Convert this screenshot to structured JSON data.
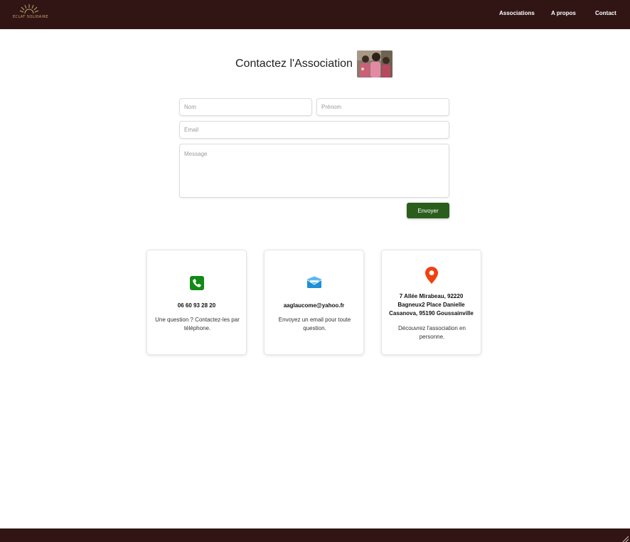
{
  "header": {
    "logo_text": "ECLAT SOLIDAIRE",
    "logo_icon": "sunrise-icon",
    "nav": [
      "Associations",
      "A propos",
      "Contact"
    ]
  },
  "page": {
    "title": "Contactez l'Association",
    "title_image": "group-photo"
  },
  "form": {
    "nom_placeholder": "Nom",
    "prenom_placeholder": "Prénom",
    "email_placeholder": "Email",
    "message_placeholder": "Message",
    "submit_label": "Envoyer"
  },
  "cards": {
    "phone": {
      "icon": "phone-icon",
      "value": "06 60 93 28 20",
      "description": "Une question ? Contactez-les par téléphone."
    },
    "email": {
      "icon": "envelope-icon",
      "value": "aaglaucome@yahoo.fr",
      "description": "Envoyez un email pour toute question."
    },
    "address": {
      "icon": "map-pin-icon",
      "value": "7 Allée Mirabeau, 92220 Bagneux2 Place Danielle Casanova, 95190 Goussainville",
      "description": "Découvrez l'association en personne."
    }
  },
  "colors": {
    "header_bg": "#311515",
    "button_green": "#2b5e1c",
    "phone_green": "#138a17",
    "pin_orange": "#f0420f",
    "logo_gold": "#c9a96a"
  }
}
